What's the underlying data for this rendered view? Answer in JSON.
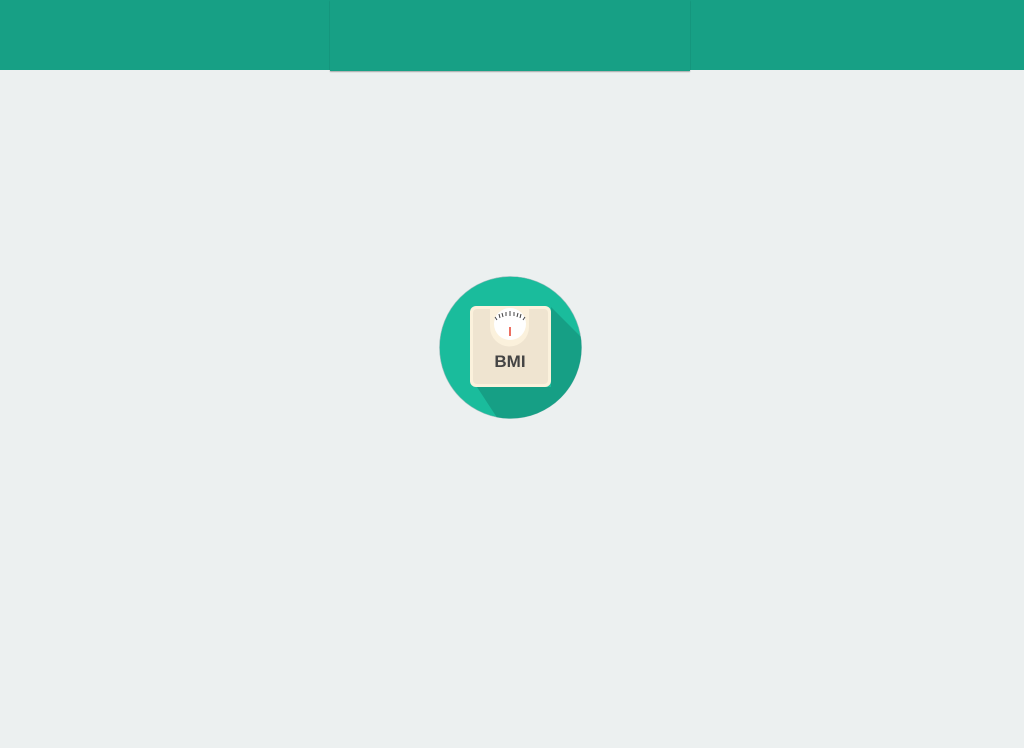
{
  "app": {
    "logo": {
      "text": "BMI",
      "icon": "bathroom-scale-icon"
    }
  },
  "colors": {
    "header": "#17a085",
    "background": "#ecf0f0",
    "logo_circle": "#1abc9c",
    "logo_shadow": "#169f85",
    "scale_body": "#efe4d0",
    "needle": "#e74c3c"
  }
}
